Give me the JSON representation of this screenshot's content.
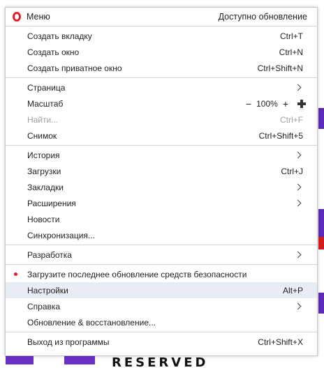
{
  "header": {
    "title": "Меню",
    "update": "Доступно обновление"
  },
  "groups": [
    [
      {
        "label": "Создать вкладку",
        "shortcut": "Ctrl+T"
      },
      {
        "label": "Создать окно",
        "shortcut": "Ctrl+N"
      },
      {
        "label": "Создать приватное окно",
        "shortcut": "Ctrl+Shift+N"
      }
    ],
    [
      {
        "label": "Страница"
      },
      {
        "label": "Масштаб",
        "zoom": {
          "minus": "−",
          "value": "100%",
          "plus": "+"
        }
      },
      {
        "label": "Найти...",
        "shortcut": "Ctrl+F",
        "disabled": true
      },
      {
        "label": "Снимок",
        "shortcut": "Ctrl+Shift+5"
      }
    ],
    [
      {
        "label": "История"
      },
      {
        "label": "Загрузки",
        "shortcut": "Ctrl+J"
      },
      {
        "label": "Закладки"
      },
      {
        "label": "Расширения"
      },
      {
        "label": "Новости"
      },
      {
        "label": "Синхронизация..."
      }
    ],
    [
      {
        "label": "Разработка"
      }
    ],
    [
      {
        "label": "Загрузите последнее обновление средств безопасности"
      },
      {
        "label": "Настройки",
        "shortcut": "Alt+P"
      },
      {
        "label": "Справка"
      },
      {
        "label": "Обновление & восстановление..."
      }
    ],
    [
      {
        "label": "Выход из программы",
        "shortcut": "Ctrl+Shift+X"
      }
    ]
  ],
  "background": {
    "banner_text": "RESERVED"
  },
  "colors": {
    "accent": "#e0212a",
    "hover": "#e8edf5",
    "purple": "#6a2fc4"
  }
}
